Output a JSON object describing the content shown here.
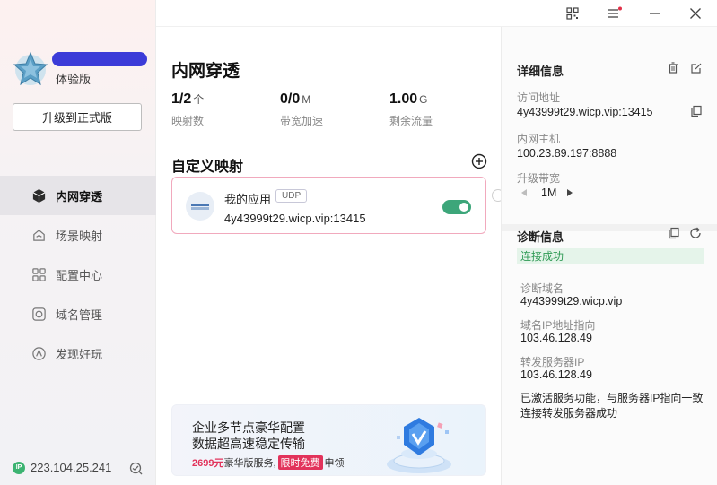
{
  "sidebar": {
    "plan_label": "体验版",
    "upgrade_label": "升级到正式版",
    "items": [
      {
        "label": "内网穿透",
        "icon": "cube-icon",
        "active": true
      },
      {
        "label": "场景映射",
        "icon": "scene-icon"
      },
      {
        "label": "配置中心",
        "icon": "grid-icon"
      },
      {
        "label": "域名管理",
        "icon": "domain-icon"
      },
      {
        "label": "发现好玩",
        "icon": "compass-icon"
      }
    ],
    "ip_badge": "IP",
    "ip_address": "223.104.25.241"
  },
  "main": {
    "title": "内网穿透",
    "stats": [
      {
        "value": "1/2",
        "unit": "个",
        "label": "映射数"
      },
      {
        "value": "0/0",
        "unit": "M",
        "label": "带宽加速"
      },
      {
        "value": "1.00",
        "unit": "G",
        "label": "剩余流量"
      }
    ],
    "section_title": "自定义映射",
    "mapping": {
      "name": "我的应用",
      "protocol": "UDP",
      "address": "4y43999t29.wicp.vip:13415",
      "enabled": true
    },
    "banner": {
      "line1": "企业多节点豪华配置",
      "line2": "数据超高速稳定传输",
      "price": "2699元",
      "price_suffix": "豪华版服务,",
      "badge": "限时免费",
      "cta": "申领"
    }
  },
  "detail": {
    "title": "详细信息",
    "visit_label": "访问地址",
    "visit_value": "4y43999t29.wicp.vip:13415",
    "host_label": "内网主机",
    "host_value": "100.23.89.197:8888",
    "bandwidth_label": "升级带宽",
    "bandwidth_value": "1M",
    "diag_title": "诊断信息",
    "diag_status": "连接成功",
    "diag_domain_label": "诊断域名",
    "diag_domain_value": "4y43999t29.wicp.vip",
    "dns_label": "域名IP地址指向",
    "dns_value": "103.46.128.49",
    "fwd_label": "转发服务器IP",
    "fwd_value": "103.46.128.49",
    "summary_line1": "已激活服务功能，与服务器IP指向一致",
    "summary_line2": "连接转发服务器成功"
  },
  "colors": {
    "accent_green": "#3da67a",
    "card_border_pink": "#f1a9bd",
    "promo_red": "#e2335b",
    "redaction_blue": "#3b3bd8"
  }
}
